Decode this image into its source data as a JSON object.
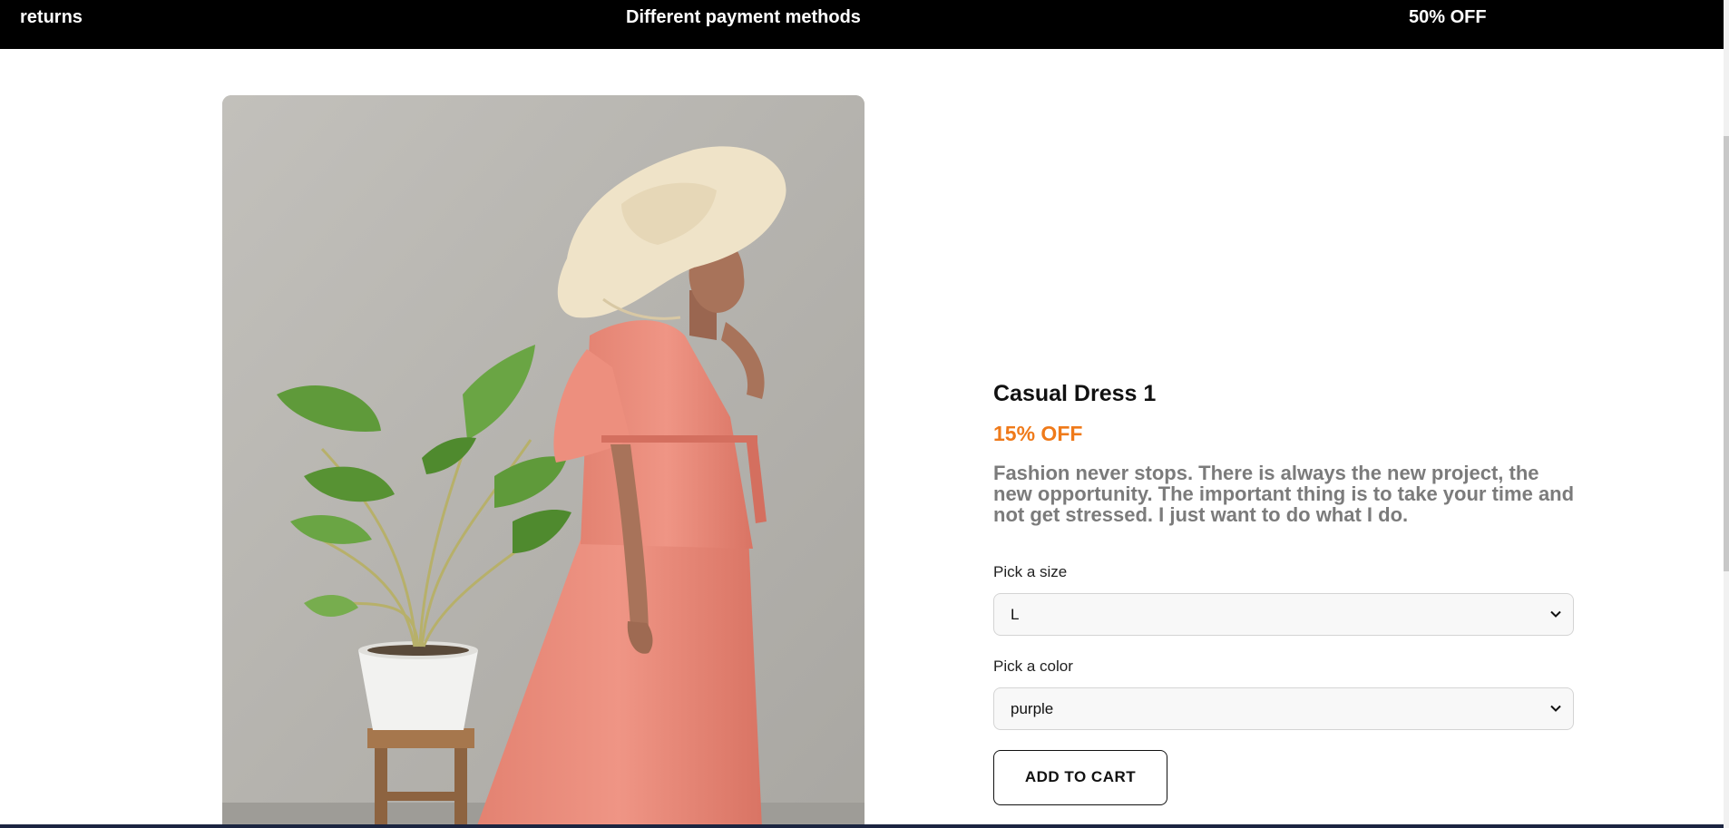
{
  "banner": {
    "messages": [
      "returns",
      "Different payment methods",
      "50% OFF"
    ]
  },
  "product": {
    "title": "Casual Dress 1",
    "discount": "15% OFF",
    "description": "Fashion never stops. There is always the new project, the new opportunity. The important thing is to take your time and not get stressed. I just want to do what I do."
  },
  "size": {
    "label": "Pick a size",
    "selected": "L"
  },
  "color": {
    "label": "Pick a color",
    "selected": "purple"
  },
  "cart": {
    "button_label": "ADD TO CART"
  },
  "colors": {
    "banner_bg": "#000000",
    "discount": "#ef7a1a",
    "description": "#7b7b7b",
    "dress": "#e98b7b"
  }
}
